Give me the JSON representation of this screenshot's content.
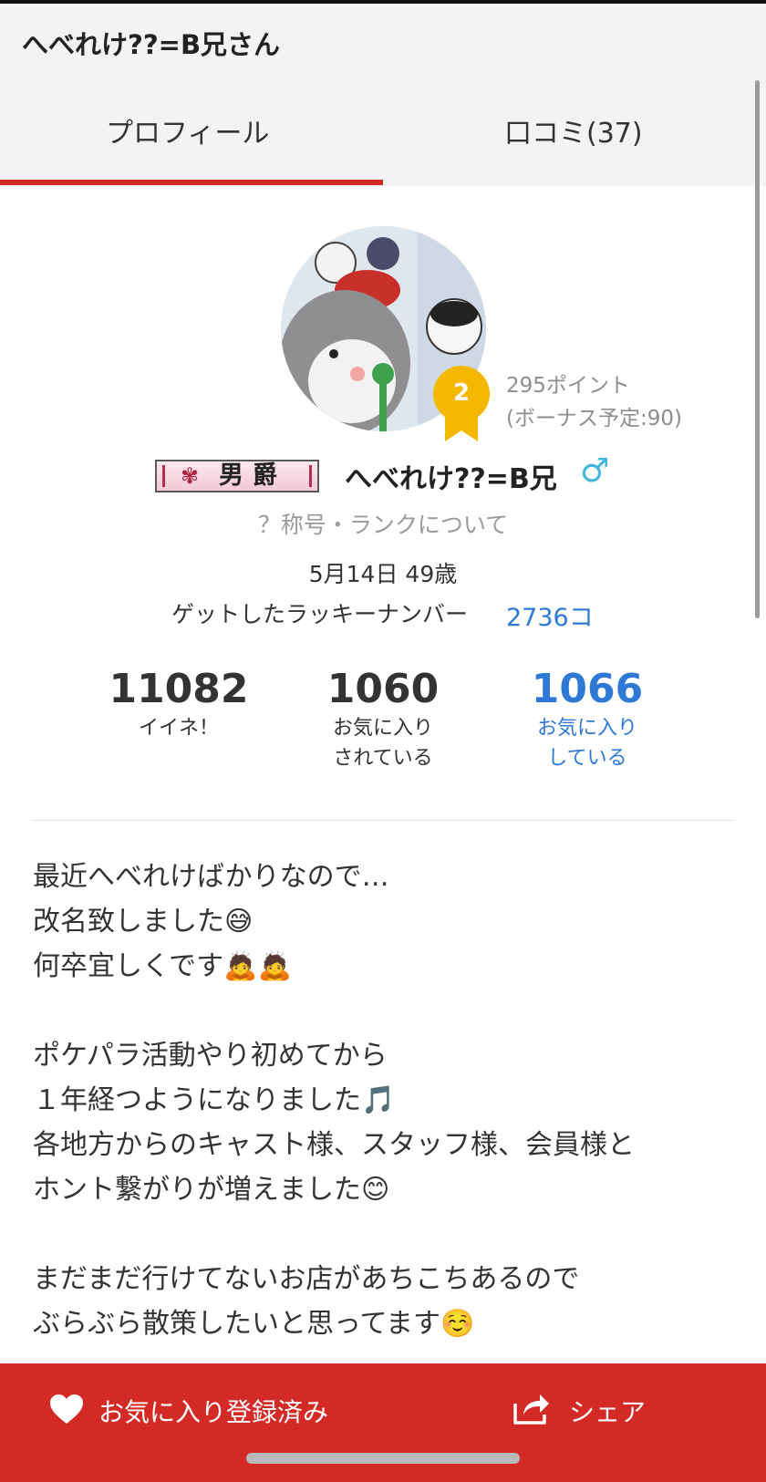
{
  "header": {
    "title": "へべれけ??=B兄さん"
  },
  "tabs": [
    {
      "label": "プロフィール",
      "active": true
    },
    {
      "label": "口コミ(37)",
      "active": false
    }
  ],
  "colors": {
    "accent": "#d42a26",
    "link": "#2e79d6",
    "gender": "#43b6dd",
    "rank_badge": "#f5b800"
  },
  "profile": {
    "avatar_icon": "penguin-avatar",
    "rank_number": "2",
    "points_line1": "295ポイント",
    "points_line2": "(ボーナス予定:90)",
    "title_badge_text": "男爵",
    "username": "へべれけ??=B兄",
    "gender_symbol": "♂",
    "rank_link": "？称号・ランクについて",
    "birthday": "5月14日 49歳",
    "lucky_label": "ゲットしたラッキーナンバー",
    "lucky_value": "2736コ"
  },
  "stats": {
    "likes": {
      "value": "11082",
      "label": "イイネ！"
    },
    "favorited": {
      "value": "1060",
      "label_line1": "お気に入り",
      "label_line2": "されている"
    },
    "favoriting": {
      "value": "1066",
      "label_line1": "お気に入り",
      "label_line2": "している"
    }
  },
  "bio": "最近へべれけばかりなので…\n改名致しました😅\n何卒宜しくです🙇🙇\n\nポケパラ活動やり初めてから\n１年経つようになりました🎵\n各地方からのキャスト様、スタッフ様、会員様と\nホント繋がりが増えました😊\n\nまだまだ行けてないお店があちこちあるので\nぶらぶら散策したいと思ってます☺️",
  "bottom_bar": {
    "favorite_label": "お気に入り登録済み",
    "share_label": "シェア"
  }
}
